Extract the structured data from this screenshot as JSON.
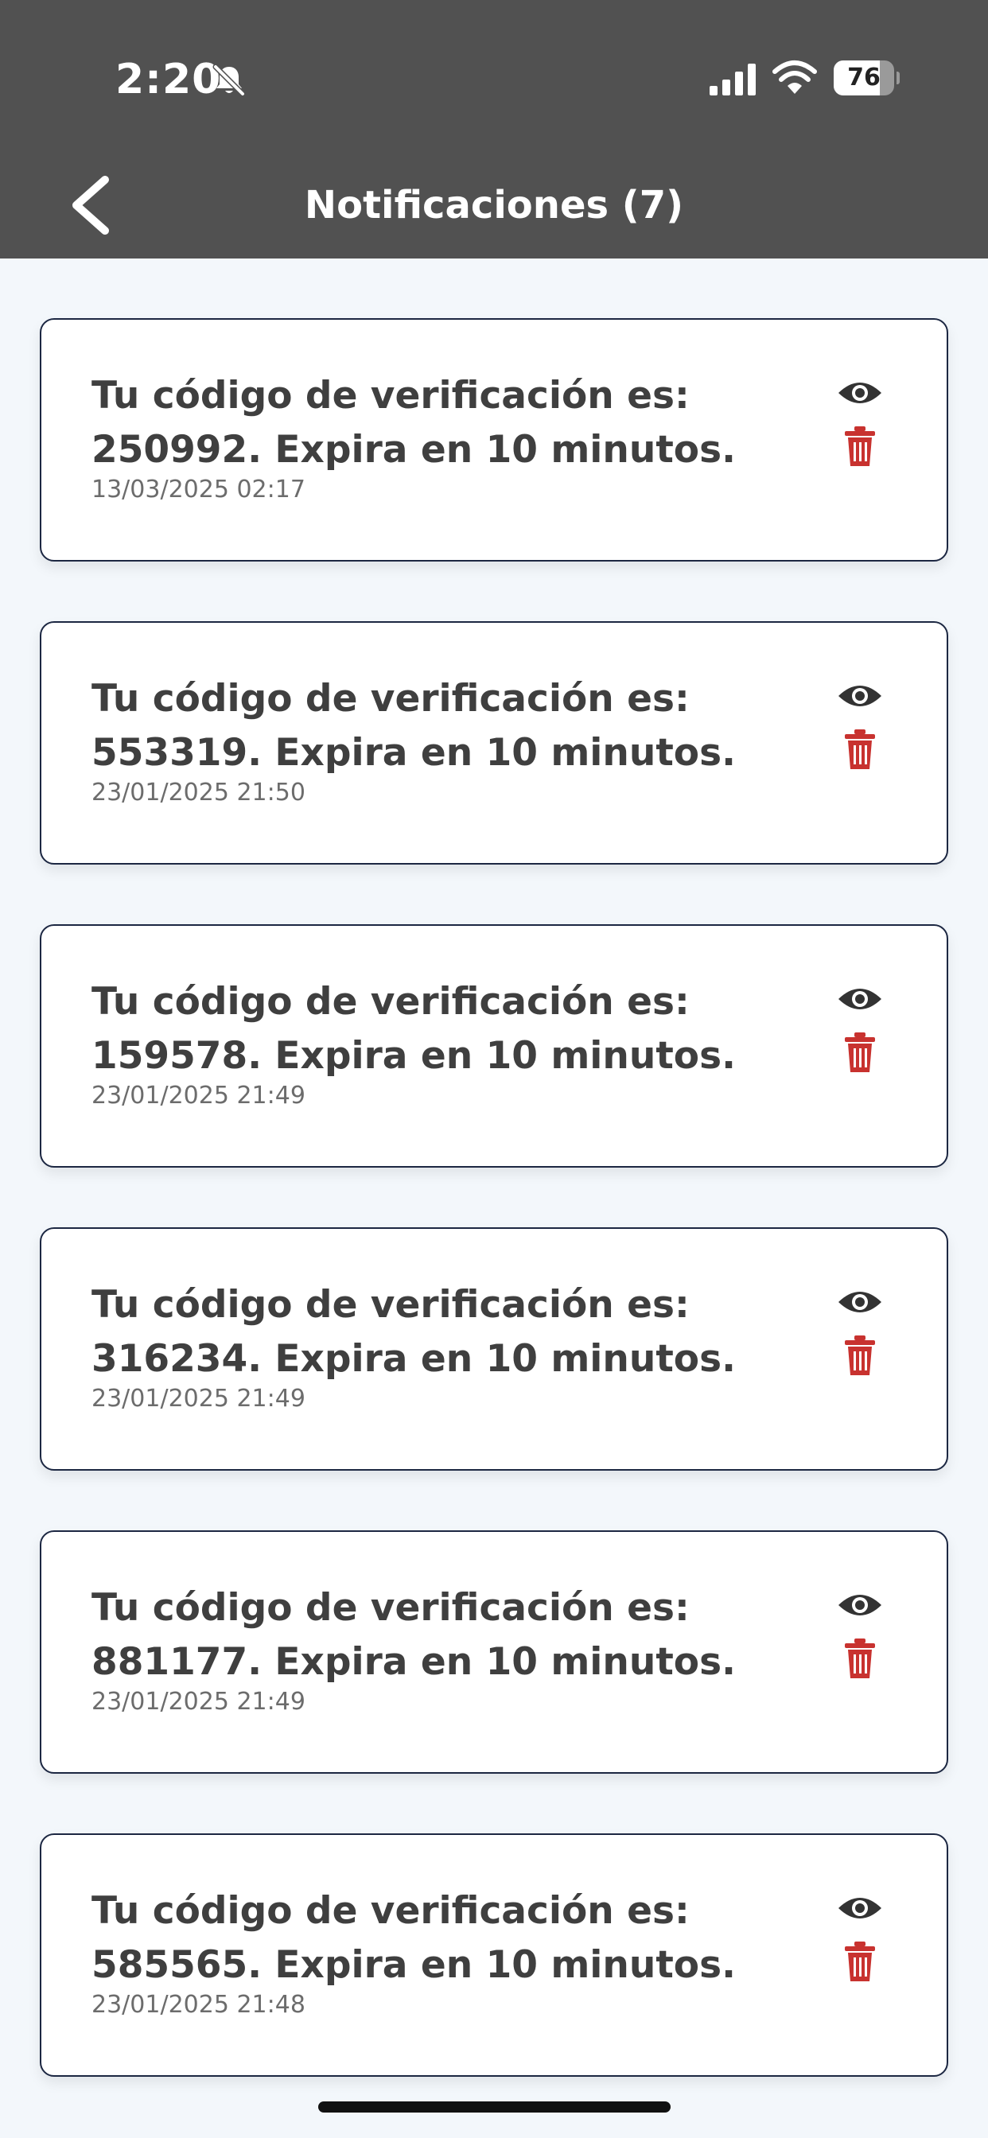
{
  "status_bar": {
    "time": "2:20",
    "battery_percent": 76
  },
  "header": {
    "title": "Notificaciones (7)"
  },
  "notifications": [
    {
      "message": "Tu código de verificación es: 250992. Expira en 10 minutos.",
      "date": "13/03/2025 02:17"
    },
    {
      "message": "Tu código de verificación es: 553319. Expira en 10 minutos.",
      "date": "23/01/2025 21:50"
    },
    {
      "message": "Tu código de verificación es: 159578. Expira en 10 minutos.",
      "date": "23/01/2025 21:49"
    },
    {
      "message": "Tu código de verificación es: 316234. Expira en 10 minutos.",
      "date": "23/01/2025 21:49"
    },
    {
      "message": "Tu código de verificación es: 881177. Expira en 10 minutos.",
      "date": "23/01/2025 21:49"
    },
    {
      "message": "Tu código de verificación es: 585565. Expira en 10 minutos.",
      "date": "23/01/2025 21:48"
    }
  ],
  "colors": {
    "header_bg": "#515151",
    "page_bg": "#f3f7fb",
    "trash": "#c8322f",
    "eye": "#333333",
    "card_border": "#1c2742"
  },
  "icons": {
    "back": "chevron-left-icon",
    "view": "eye-icon",
    "delete": "trash-icon",
    "silent": "bell-slash-icon",
    "signal": "signal-bars-icon",
    "wifi": "wifi-icon",
    "battery": "battery-icon"
  }
}
